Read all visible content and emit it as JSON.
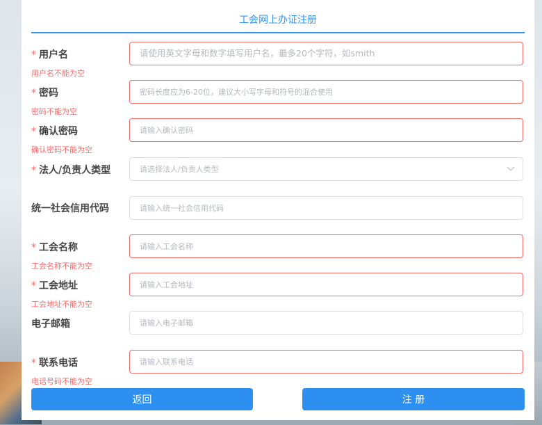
{
  "form": {
    "title": "工会网上办证注册",
    "required_mark": "*",
    "fields": [
      {
        "label": "用户名",
        "required": true,
        "placeholder": "请使用英文字母和数字填写用户名，最多20个字符，如smith",
        "error": "用户名不能为空"
      },
      {
        "label": "密码",
        "required": true,
        "placeholder": "密码长度应为6-20位，建议大小写字母和符号的混合使用",
        "error": "密码不能为空"
      },
      {
        "label": "确认密码",
        "required": true,
        "placeholder": "请输入确认密码",
        "error": "确认密码不能为空"
      },
      {
        "label": "法人/负责人类型",
        "required": true,
        "placeholder": "请选择法人/负责人类型",
        "error": ""
      },
      {
        "label": "统一社会信用代码",
        "required": false,
        "placeholder": "请输入统一社会信用代码",
        "error": ""
      },
      {
        "label": "工会名称",
        "required": true,
        "placeholder": "请输入工会名称",
        "error": "工会名称不能为空"
      },
      {
        "label": "工会地址",
        "required": true,
        "placeholder": "请输入工会地址",
        "error": "工会地址不能为空"
      },
      {
        "label": "电子邮箱",
        "required": false,
        "placeholder": "请输入电子邮箱",
        "error": ""
      },
      {
        "label": "联系电话",
        "required": true,
        "placeholder": "请输入联系电话",
        "error": "电话号码不能为空"
      }
    ],
    "buttons": {
      "back": "返回",
      "register": "注 册"
    }
  },
  "colors": {
    "accent": "#2f96f3",
    "button": "#2d8ff0",
    "error": "#f56c6c",
    "border": "#dcdfe6"
  }
}
